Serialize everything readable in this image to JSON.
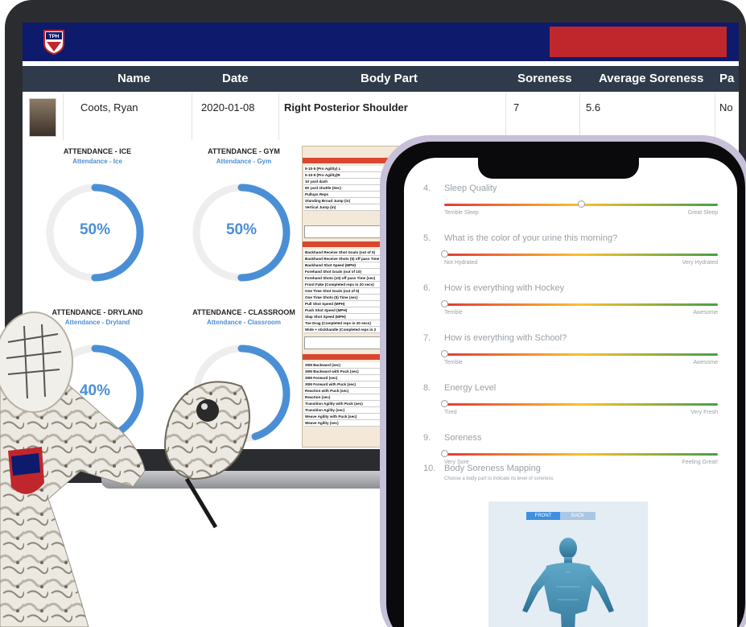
{
  "app": {
    "logo_text": "TPH",
    "colors": {
      "header": "#0e1a6b",
      "accent_red": "#c0272d",
      "ring_blue": "#4a8fd6",
      "table_head": "#2f3a4a"
    }
  },
  "table": {
    "columns": [
      "Name",
      "Date",
      "Body Part",
      "Soreness",
      "Average Soreness",
      "Pa"
    ],
    "row": {
      "name": "Coots, Ryan",
      "date": "2020-01-08",
      "body_part": "Right Posterior Shoulder",
      "soreness": "7",
      "average_soreness": "5.6",
      "pa": "No"
    }
  },
  "attendance": [
    {
      "title": "ATTENDANCE - ICE",
      "subtitle": "Attendance - Ice",
      "value_text": "50%",
      "value": 0.5
    },
    {
      "title": "ATTENDANCE - GYM",
      "subtitle": "Attendance - Gym",
      "value_text": "50%",
      "value": 0.5
    },
    {
      "title": "ATTENDANCE - DRYLAND",
      "subtitle": "Attendance - Dryland",
      "value_text": "40%",
      "value": 0.4
    },
    {
      "title": "ATTENDANCE - CLASSROOM",
      "subtitle": "Attendance - Classroom",
      "value_text": "",
      "value": 0.45
    }
  ],
  "spreadsheet": {
    "group1": [
      "5-10-5 (Pro Agility) L",
      "5-10-5 (Pro Agility)R",
      "10 yard dash",
      "60 yard shuttle (Sec)",
      "Pullups Reps",
      "Standing Broad Jump (in)",
      "Vertical Jump (in)"
    ],
    "group2": [
      "Backhand Receive Shot Goals (out of 5)",
      "Backhand Receive Shots (5) off pass Time",
      "Backhand Shot Speed (MPH)",
      "Forehand Shot Goals (out of 10)",
      "Forehand Shots (10) off pass Time (sec)",
      "Front Fake (Completed reps in 20 secs)",
      "One Time Shot Goals (out of 5)",
      "One Time Shots (5) Time (sec)",
      "Pull Shot Speed (MPH)",
      "Push Shot Speed (MPH)",
      "Slap Shot Speed (MPH)",
      "Toe Drag (Completed reps in 20 secs)",
      "Wide + stickhandle (Completed reps in 2"
    ],
    "group3": [
      "30M Backward (sec)",
      "30M Backward with Puck (sec)",
      "30M Forward (sec)",
      "30M Forward with Puck (sec)",
      "Reaction with Puck (sec)",
      "Reaction (sec)",
      "Transition Agility with Puck (sec)",
      "Transition Agility (sec)",
      "Weave Agility with Puck (sec)",
      "Weave Agility (sec)"
    ]
  },
  "survey": [
    {
      "num": "4.",
      "text": "Sleep Quality",
      "left": "Terrible Sleep",
      "right": "Great Sleep",
      "value": 0.5
    },
    {
      "num": "5.",
      "text": "What is the color of your urine this morning?",
      "left": "Not Hydrated",
      "right": "Very Hydrated",
      "value": 0.0
    },
    {
      "num": "6.",
      "text": "How is everything with Hockey",
      "left": "Terrible",
      "right": "Awesome",
      "value": 0.0
    },
    {
      "num": "7.",
      "text": "How is everything with School?",
      "left": "Terrible",
      "right": "Awesome",
      "value": 0.0
    },
    {
      "num": "8.",
      "text": "Energy Level",
      "left": "Tired",
      "right": "Very Fresh",
      "value": 0.0
    },
    {
      "num": "9.",
      "text": "Soreness",
      "left": "Very Sore",
      "right": "Feeling Great!",
      "value": 0.0
    }
  ],
  "body_mapping": {
    "num": "10.",
    "text": "Body Soreness Mapping",
    "hint": "Choose a body part to indicate its level of soreness",
    "front_label": "FRONT",
    "back_label": "BACK"
  }
}
